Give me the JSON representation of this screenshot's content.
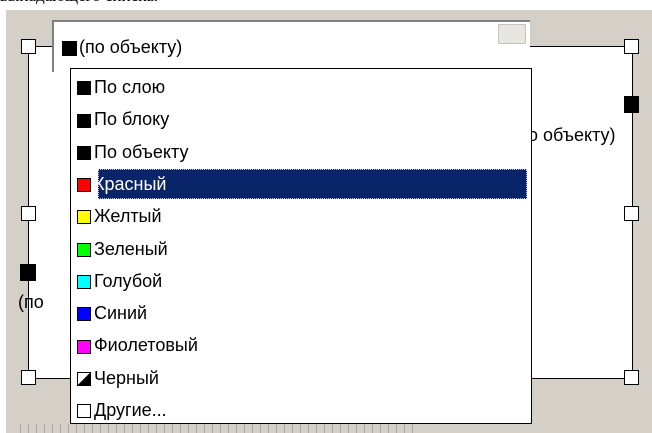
{
  "caption": "выпадающего списка.",
  "combo": {
    "selected_label": "(по объекту)",
    "selected_swatch_color": "#000000"
  },
  "canvas_labels": {
    "right_partial": "о объекту)",
    "left_partial": "(по"
  },
  "dropdown": {
    "items": [
      {
        "label": "По слою",
        "swatch": "#000000",
        "icon": "black-square-icon"
      },
      {
        "label": "По блоку",
        "swatch": "#000000",
        "icon": "black-square-icon"
      },
      {
        "label": "По объекту",
        "swatch": "#000000",
        "icon": "black-square-icon"
      },
      {
        "label": "Красный",
        "swatch": "#ff0000",
        "icon": "red-square-icon",
        "selected": true
      },
      {
        "label": "Желтый",
        "swatch": "#ffff00",
        "icon": "yellow-square-icon"
      },
      {
        "label": "Зеленый",
        "swatch": "#00ff00",
        "icon": "green-square-icon"
      },
      {
        "label": "Голубой",
        "swatch": "#00ffff",
        "icon": "cyan-square-icon"
      },
      {
        "label": "Синий",
        "swatch": "#0000ff",
        "icon": "blue-square-icon"
      },
      {
        "label": "Фиолетовый",
        "swatch": "#ff00ff",
        "icon": "magenta-square-icon"
      },
      {
        "label": "Черный",
        "swatch": "diagonal",
        "icon": "black-white-diagonal-icon"
      },
      {
        "label": "Другие...",
        "swatch": "#ffffff",
        "icon": "white-square-icon"
      }
    ]
  },
  "colors": {
    "highlight": "#0a246a",
    "panel": "#d4d0c8"
  }
}
